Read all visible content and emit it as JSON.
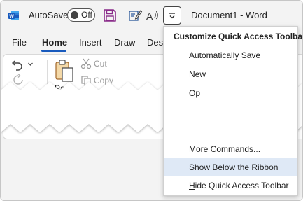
{
  "app": {
    "autosave_label": "AutoSave",
    "autosave_state": "Off",
    "document_title": "Document1  -  Word"
  },
  "tabs": [
    {
      "label": "File"
    },
    {
      "label": "Home"
    },
    {
      "label": "Insert"
    },
    {
      "label": "Draw"
    },
    {
      "label": "Desi"
    }
  ],
  "ribbon": {
    "paste_label": "Paste",
    "cut_label": "Cut",
    "copy_label": "Copy"
  },
  "menu": {
    "header": "Customize Quick Access Toolbar",
    "items": [
      {
        "label": "Automatically Save"
      },
      {
        "label": "New"
      },
      {
        "label": "Op"
      },
      {
        "label": "More Commands..."
      },
      {
        "label": "Show Below the Ribbon",
        "highlighted": true
      },
      {
        "label_prefix": "H",
        "label_rest": "ide Quick Access Toolbar"
      }
    ]
  },
  "colors": {
    "word_blue": "#185abd",
    "save_purple": "#8a2c8a",
    "menu_highlight": "#dfe9f6"
  },
  "icons": [
    "word-logo-icon",
    "save-icon",
    "edit-icon",
    "read-aloud-icon",
    "customize-chevron-icon",
    "undo-icon",
    "redo-icon",
    "paste-icon",
    "cut-icon",
    "copy-icon"
  ]
}
